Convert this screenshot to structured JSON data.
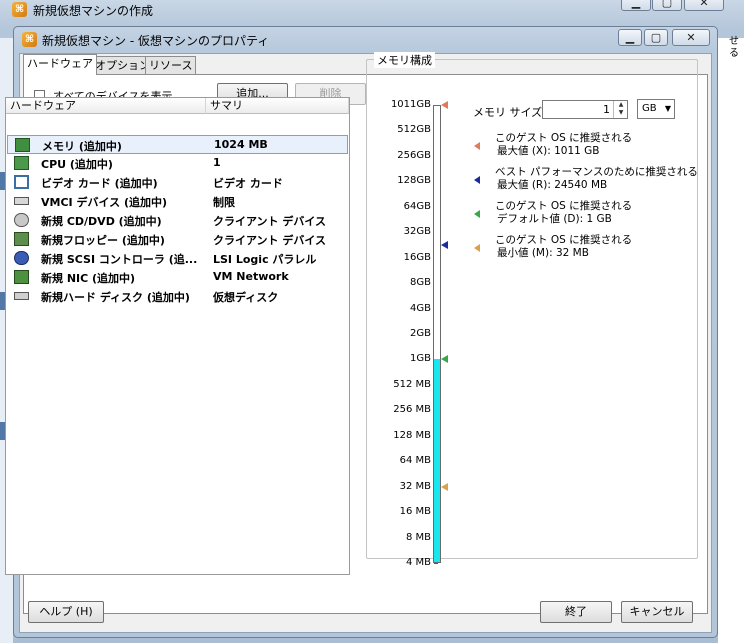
{
  "outer_window": {
    "title": "新規仮想マシンの作成",
    "right_edge_text": "せる"
  },
  "dialog": {
    "title": "新規仮想マシン - 仮想マシンのプロパティ",
    "tabs": [
      {
        "label": "ハードウェア",
        "active": true
      },
      {
        "label": "オプション",
        "active": false
      },
      {
        "label": "リソース",
        "active": false
      }
    ],
    "show_all_devices": {
      "label": "すべてのデバイスを表示",
      "checked": false
    },
    "add_button": "追加...",
    "remove_button": "削除",
    "hardware_table": {
      "columns": [
        "ハードウェア",
        "サマリ"
      ],
      "rows": [
        {
          "icon": "memory-icon",
          "name": "メモリ (追加中)",
          "summary": "1024 MB",
          "selected": true
        },
        {
          "icon": "cpu-icon",
          "name": "CPU (追加中)",
          "summary": "1"
        },
        {
          "icon": "video-card-icon",
          "name": "ビデオ カード (追加中)",
          "summary": "ビデオ カード"
        },
        {
          "icon": "vmci-device-icon",
          "name": "VMCI デバイス (追加中)",
          "summary": "制限"
        },
        {
          "icon": "cd-dvd-icon",
          "name": "新規 CD/DVD (追加中)",
          "summary": "クライアント デバイス"
        },
        {
          "icon": "floppy-icon",
          "name": "新規フロッピー (追加中)",
          "summary": "クライアント デバイス"
        },
        {
          "icon": "scsi-controller-icon",
          "name": "新規 SCSI コントローラ (追...",
          "summary": "LSI Logic パラレル"
        },
        {
          "icon": "network-card-icon",
          "name": "新規 NIC (追加中)",
          "summary": "VM Network"
        },
        {
          "icon": "hard-disk-icon",
          "name": "新規ハード ディスク (追加中)",
          "summary": "仮想ディスク"
        }
      ]
    },
    "memory": {
      "group_title": "メモリ構成",
      "size_label": "メモリ サイズ:",
      "size_value": "1",
      "unit": "GB",
      "scale_labels": [
        "1011GB",
        "512GB",
        "256GB",
        "128GB",
        "64GB",
        "32GB",
        "16GB",
        "8GB",
        "4GB",
        "2GB",
        "1GB",
        "512 MB",
        "256 MB",
        "128 MB",
        "64 MB",
        "32 MB",
        "16 MB",
        "8 MB",
        "4 MB"
      ],
      "filled_to": "1GB",
      "legend": [
        {
          "color": "#e07a5f",
          "line1": "このゲスト OS に推奨される",
          "line2": "最大値 (X): 1011 GB"
        },
        {
          "color": "#1f2a9c",
          "line1": "ベスト パフォーマンスのために推奨される",
          "line2": "最大値 (R): 24540 MB"
        },
        {
          "color": "#3aa64a",
          "line1": "このゲスト OS に推奨される",
          "line2": "デフォルト値 (D): 1 GB"
        },
        {
          "color": "#d9a050",
          "line1": "このゲスト OS に推奨される",
          "line2": "最小値 (M): 32 MB"
        }
      ]
    },
    "help_button": "ヘルプ (H)",
    "finish_button": "終了",
    "cancel_button": "キャンセル"
  }
}
